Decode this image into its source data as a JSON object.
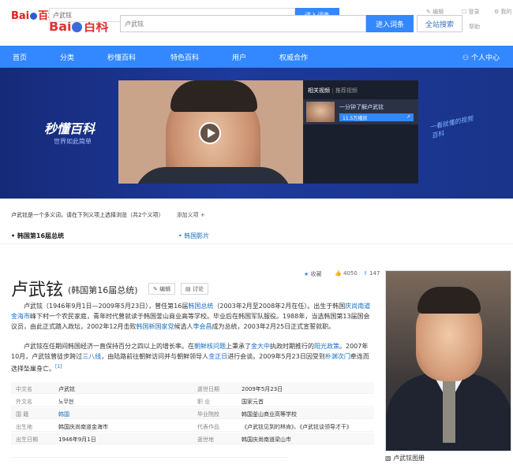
{
  "header": {
    "logo_a": "Bai",
    "logo_a_tail": "百科",
    "logo_a_paw": "du",
    "logo_b": "Bai",
    "logo_b_paw": "du",
    "logo_b_tail": "百科",
    "search_value_small": "卢武铉",
    "enter_btn_small": "进入词条",
    "search_value": "卢武铉",
    "enter_btn": "进入词条",
    "fulltext_btn": "全站搜索",
    "help": "帮助",
    "link1": "编辑",
    "link2": "登录",
    "link3": "我的"
  },
  "nav": {
    "items": [
      "首页",
      "分类",
      "秒懂百科",
      "特色百科",
      "用户",
      "权威合作"
    ],
    "user_center": "个人中心"
  },
  "banner": {
    "brand": "秒懂百科",
    "brand_sub": "世界如此简单",
    "related_tab1": "相关视频",
    "related_tab2": "推荐视频",
    "related_item_title": "一分钟了解卢武铉",
    "related_item_plays": "11.5万播放",
    "handwriting": "一看就懂的视频百科"
  },
  "disambiguation": {
    "text": "卢武铉是一个多义词，请在下列义项上选择浏览（共2个义项）",
    "add": "添加义项 +"
  },
  "tabs": {
    "tab1": "韩国第16届总统",
    "tab2": "韩国影片"
  },
  "title": {
    "main": "卢武铉",
    "sub": "(韩国第16届总统)",
    "edit": "编辑",
    "discuss": "讨论",
    "collect": "收藏",
    "likes": "4050",
    "shares": "147"
  },
  "intro": {
    "p1_a": "卢武铉（1946年9月1日—2009年5月23日），曾任第16届",
    "p1_l1": "韩国总统",
    "p1_b": "（2003年2月至2008年2月在任）。出生于韩国",
    "p1_l2": "庆尚南道金海市",
    "p1_c": "峰下村一个农民家庭，青年时代曾就读于韩国釜山商业高等学校。毕业后在韩国军队服役。1988年，当选韩国第13届国会议员，由此正式踏入政坛，2002年12月击败",
    "p1_l3": "韩国新国家党",
    "p1_d": "候选人",
    "p1_l4": "李会昌",
    "p1_e": "成为总统，2003年2月25日正式宣誓就职。",
    "p2_a": "卢武铉在任期间韩国经济一直保持百分之四以上的增长率。在",
    "p2_l1": "朝鲜核问题",
    "p2_b": "上秉承了",
    "p2_l2": "金大中",
    "p2_c": "执政时期推行的",
    "p2_l3": "阳光政策",
    "p2_d": "。2007年10月，卢武铉曾徒步跨过",
    "p2_l4": "三八线",
    "p2_e": "，由陆路前往朝鲜访问并与朝鲜领导人",
    "p2_l5": "金正日",
    "p2_f": "进行会谈。2009年5月23日因受到",
    "p2_l6": "朴渊次门",
    "p2_g": "牵连而选择坠崖身亡。",
    "ref": "[1]"
  },
  "infobox": [
    {
      "k1": "中文名",
      "v1": "卢武铉",
      "k2": "逝世日期",
      "v2": "2009年5月23日"
    },
    {
      "k1": "外文名",
      "v1": "노무현",
      "k2": "职    业",
      "v2": "国家元首"
    },
    {
      "k1": "国    籍",
      "v1": "韩国",
      "k2": "毕业院校",
      "v2": "韩国釜山商业高等学校"
    },
    {
      "k1": "出生地",
      "v1": "韩国庆尚南道金海市",
      "k2": "代表作品",
      "v2": "《卢武铉见到的林肯》、《卢武铉谈领导才干》"
    },
    {
      "k1": "出生日期",
      "v1": "1946年9月1日",
      "k2": "逝世地",
      "v2": "韩国庆尚南道梁山市"
    }
  ],
  "photo": {
    "caption": "卢武铉图册"
  },
  "colors": {
    "nav": "#3388ff",
    "banner": "#1d3a9c",
    "link": "#136ec2"
  }
}
